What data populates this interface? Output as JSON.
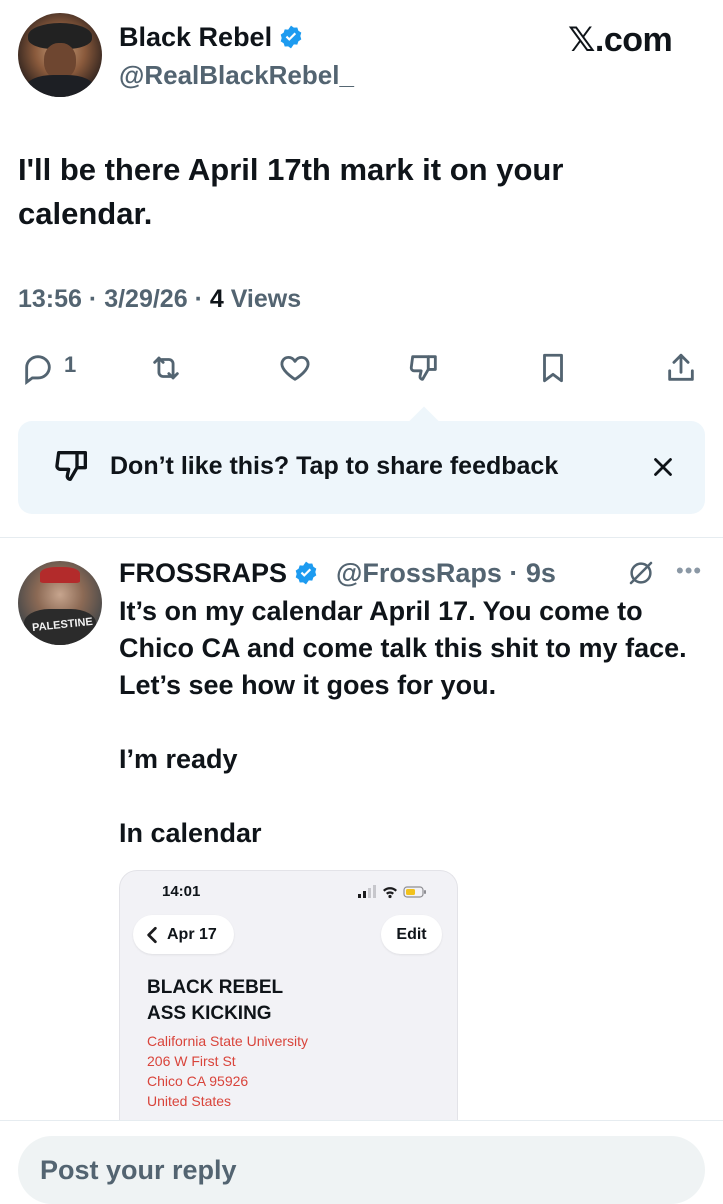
{
  "brand": "𝕏.com",
  "original": {
    "author_name": "Black Rebel",
    "handle": "@RealBlackRebel_",
    "text": "I'll be there April 17th mark it on your calendar.",
    "time": "13:56",
    "date": "3/29/26",
    "views_count": "4",
    "views_label": "Views",
    "reply_count": "1"
  },
  "feedback": {
    "text": "Don’t like this? Tap to share feedback"
  },
  "reply": {
    "author_name": "FROSSRAPS",
    "handle": "@FrossRaps",
    "age": "9s",
    "paragraphs": [
      "It’s on my calendar April 17. You come to Chico CA and come talk this shit to my face. Let’s see how it goes for you.",
      "I’m ready",
      "In calendar"
    ],
    "avatar_shirt_text": "PALESTINE"
  },
  "calendar_screenshot": {
    "time": "14:01",
    "back_label": "Apr 17",
    "edit_label": "Edit",
    "event_title_line1": "BLACK REBEL",
    "event_title_line2": "ASS KICKING",
    "address": [
      "California State University",
      "206 W First St",
      "Chico CA 95926",
      "United States"
    ]
  },
  "composer": {
    "placeholder": "Post your reply"
  },
  "colors": {
    "verified": "#1d9bf0",
    "secondary_text": "#536471",
    "banner_bg": "#eef6fb",
    "address_red": "#d9443b"
  }
}
